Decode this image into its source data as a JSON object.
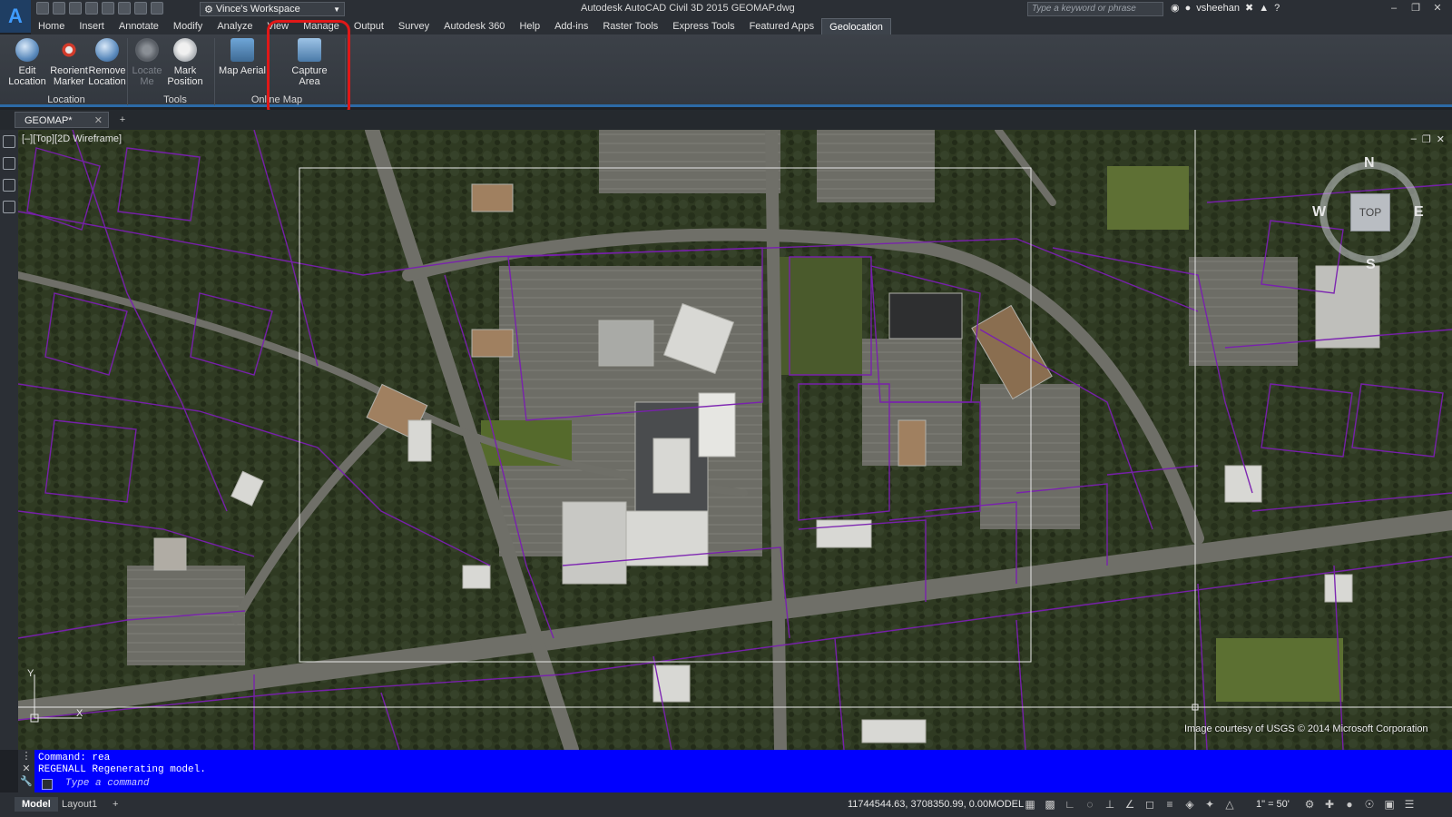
{
  "app": {
    "logo_letter": "A",
    "workspace": "Vince's Workspace",
    "title": "Autodesk AutoCAD Civil 3D 2015   GEOMAP.dwg",
    "search_placeholder": "Type a keyword or phrase",
    "user": "vsheehan"
  },
  "menu_tabs": [
    {
      "label": "Home"
    },
    {
      "label": "Insert"
    },
    {
      "label": "Annotate"
    },
    {
      "label": "Modify"
    },
    {
      "label": "Analyze"
    },
    {
      "label": "View"
    },
    {
      "label": "Manage"
    },
    {
      "label": "Output"
    },
    {
      "label": "Survey"
    },
    {
      "label": "Autodesk 360"
    },
    {
      "label": "Help"
    },
    {
      "label": "Add-ins"
    },
    {
      "label": "Raster Tools"
    },
    {
      "label": "Express Tools"
    },
    {
      "label": "Featured Apps"
    },
    {
      "label": "Geolocation",
      "active": true
    }
  ],
  "ribbon": {
    "buttons": {
      "edit_location": "Edit Location",
      "reorient_marker": "Reorient Marker",
      "remove_location": "Remove Location",
      "locate_me": "Locate Me",
      "mark_position": "Mark Position",
      "map_aerial": "Map Aerial",
      "capture_area": "Capture Area"
    },
    "panels": {
      "location": "Location",
      "tools": "Tools",
      "online_map": "Online Map"
    }
  },
  "document_tab": "GEOMAP*",
  "viewport": {
    "label": "[–][Top][2D Wireframe]",
    "viewcube": {
      "top": "TOP",
      "n": "N",
      "s": "S",
      "e": "E",
      "w": "W"
    },
    "attribution": "Image courtesy of USGS © 2014 Microsoft Corporation"
  },
  "command": {
    "line1": "Command: rea",
    "line2": "REGENALL Regenerating model.",
    "placeholder": "Type a command"
  },
  "status": {
    "layout_model": "Model",
    "layout_1": "Layout1",
    "coordinates": "11744544.63, 3708350.99, 0.00",
    "space": "MODEL",
    "scale": "1\" = 50'"
  },
  "colors": {
    "ribbon_accent": "#2c6aa6",
    "parcel_lines": "#7a1fb0",
    "command_bg": "#0000ff",
    "highlight": "#e01818"
  }
}
